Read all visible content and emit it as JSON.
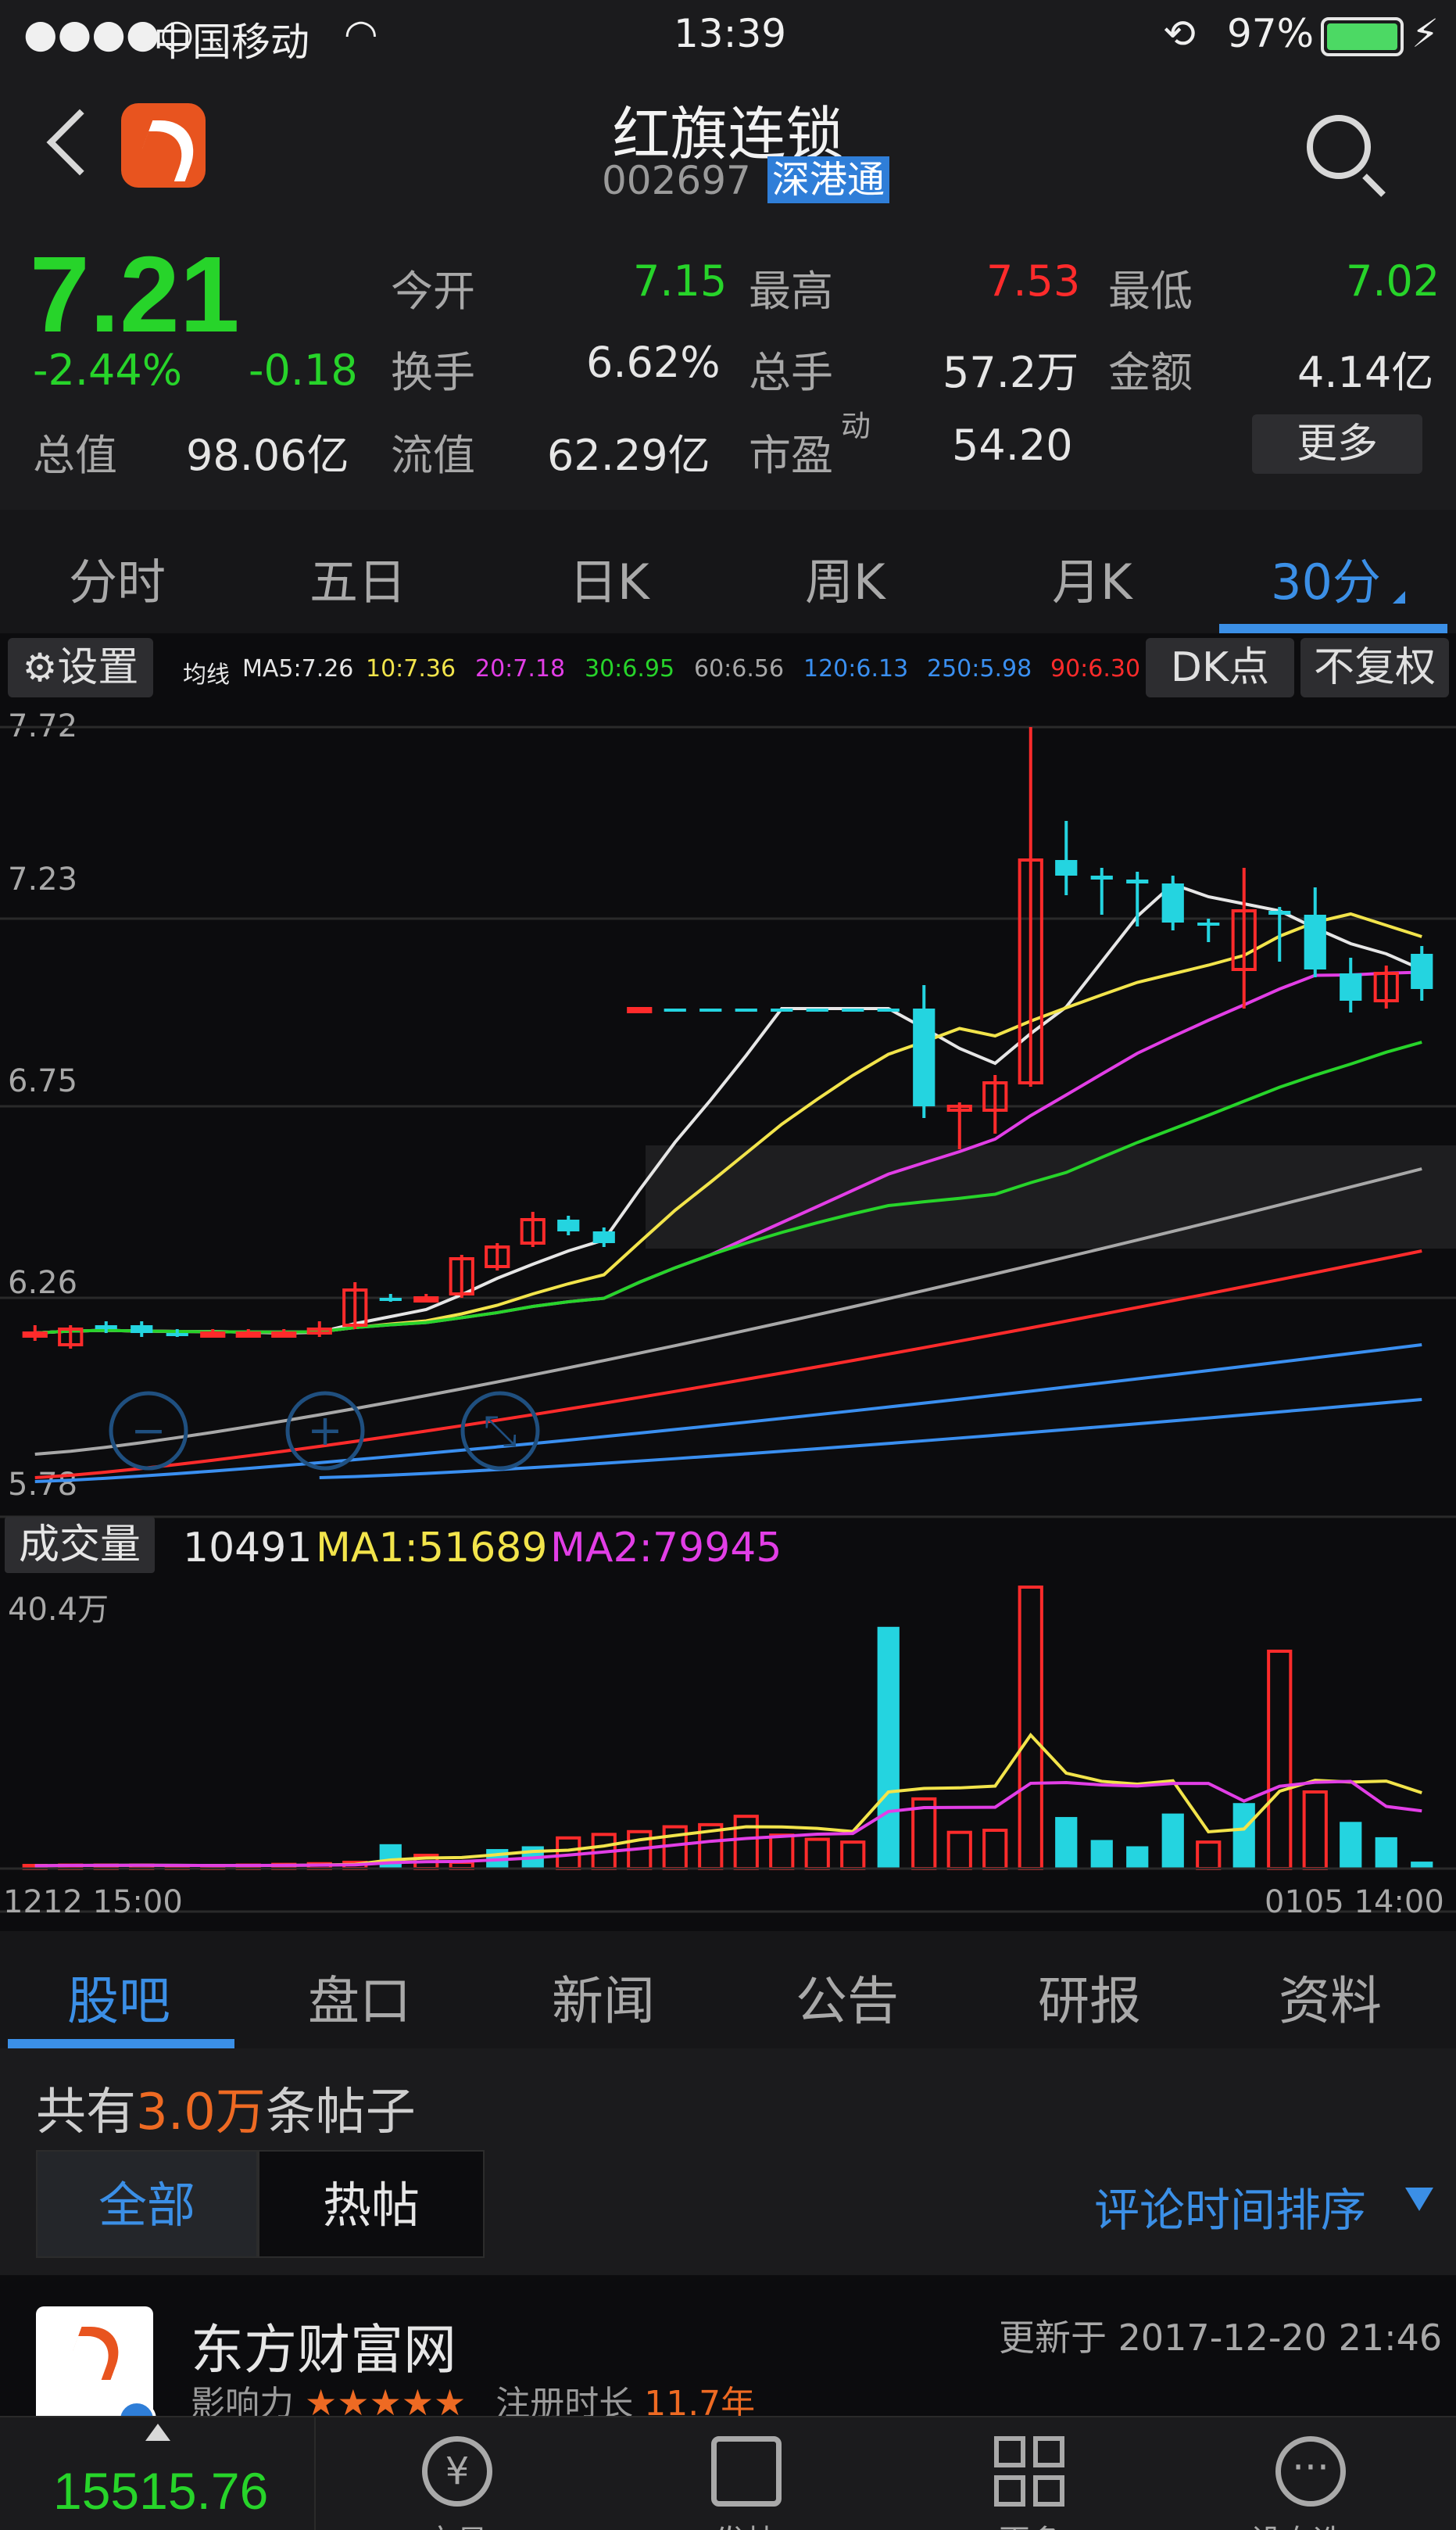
{
  "status_bar": {
    "signal": "●●●●○",
    "carrier": "中国移动",
    "wifi_icon": "wifi-icon",
    "time": "13:39",
    "battery_pct": "97%"
  },
  "header": {
    "stock_name": "红旗连锁",
    "stock_code": "002697",
    "connect_badge": "深港通"
  },
  "quote": {
    "price": "7.21",
    "change_pct": "-2.44%",
    "change": "-0.18",
    "open_label": "今开",
    "open": "7.15",
    "high_label": "最高",
    "high": "7.53",
    "low_label": "最低",
    "low": "7.02",
    "turnover_label": "换手",
    "turnover": "6.62%",
    "volume_label": "总手",
    "volume": "57.2万",
    "amount_label": "金额",
    "amount": "4.14亿",
    "mktcap_label": "总值",
    "mktcap": "98.06亿",
    "float_label": "流值",
    "float": "62.29亿",
    "pe_label": "市盈",
    "pe_sup": "动",
    "pe": "54.20",
    "more_button": "更多"
  },
  "period_tabs": [
    "分时",
    "五日",
    "日K",
    "周K",
    "月K",
    "30分"
  ],
  "indicator": {
    "settings_label": "设置",
    "ma_label": "均线",
    "ma_items": [
      {
        "text": "MA5:7.26",
        "color": "#e6e6e6"
      },
      {
        "text": "10:7.36",
        "color": "#f2e44b"
      },
      {
        "text": "20:7.18",
        "color": "#e23ee6"
      },
      {
        "text": "30:6.95",
        "color": "#27d42a"
      },
      {
        "text": "60:6.56",
        "color": "#a8a8a8"
      },
      {
        "text": "120:6.13",
        "color": "#3a8ff0"
      },
      {
        "text": "250:5.98",
        "color": "#3a8ff0"
      },
      {
        "text": "90:6.30",
        "color": "#ff2b2b"
      }
    ],
    "dk_button": "DK点",
    "adjust_button": "不复权"
  },
  "price_axis": [
    "7.72",
    "7.23",
    "6.75",
    "6.26",
    "5.78"
  ],
  "volume": {
    "label": "成交量",
    "value": "10491",
    "ma1": "MA1:51689",
    "ma2": "MA2:79945",
    "axis_max": "40.4万",
    "date_start": "1212 15:00",
    "date_end": "0105 14:00"
  },
  "chart_data": {
    "type": "candlestick",
    "ylim": [
      5.78,
      7.72
    ],
    "candles": [
      {
        "o": 6.17,
        "c": 6.17,
        "h": 6.19,
        "l": 6.15,
        "up": true
      },
      {
        "o": 6.14,
        "c": 6.18,
        "h": 6.19,
        "l": 6.13,
        "up": true
      },
      {
        "o": 6.19,
        "c": 6.18,
        "h": 6.2,
        "l": 6.17,
        "up": false
      },
      {
        "o": 6.19,
        "c": 6.17,
        "h": 6.2,
        "l": 6.16,
        "up": false
      },
      {
        "o": 6.17,
        "c": 6.17,
        "h": 6.18,
        "l": 6.16,
        "up": false
      },
      {
        "o": 6.17,
        "c": 6.17,
        "h": 6.18,
        "l": 6.16,
        "up": true
      },
      {
        "o": 6.17,
        "c": 6.17,
        "h": 6.18,
        "l": 6.16,
        "up": true
      },
      {
        "o": 6.17,
        "c": 6.17,
        "h": 6.18,
        "l": 6.16,
        "up": true
      },
      {
        "o": 6.17,
        "c": 6.18,
        "h": 6.2,
        "l": 6.16,
        "up": true
      },
      {
        "o": 6.19,
        "c": 6.28,
        "h": 6.3,
        "l": 6.18,
        "up": true
      },
      {
        "o": 6.26,
        "c": 6.26,
        "h": 6.27,
        "l": 6.25,
        "up": false
      },
      {
        "o": 6.26,
        "c": 6.26,
        "h": 6.27,
        "l": 6.25,
        "up": true
      },
      {
        "o": 6.27,
        "c": 6.36,
        "h": 6.37,
        "l": 6.26,
        "up": true
      },
      {
        "o": 6.34,
        "c": 6.39,
        "h": 6.4,
        "l": 6.33,
        "up": true
      },
      {
        "o": 6.4,
        "c": 6.46,
        "h": 6.48,
        "l": 6.39,
        "up": true
      },
      {
        "o": 6.46,
        "c": 6.43,
        "h": 6.47,
        "l": 6.42,
        "up": false
      },
      {
        "o": 6.43,
        "c": 6.4,
        "h": 6.44,
        "l": 6.39,
        "up": false
      },
      {
        "o": 7.0,
        "c": 7.0,
        "h": 7.0,
        "l": 7.0,
        "up": true
      },
      {
        "o": 7.0,
        "c": 7.0,
        "h": 7.0,
        "l": 7.0,
        "up": false
      },
      {
        "o": 7.0,
        "c": 7.0,
        "h": 7.0,
        "l": 7.0,
        "up": false
      },
      {
        "o": 7.0,
        "c": 7.0,
        "h": 7.0,
        "l": 7.0,
        "up": false
      },
      {
        "o": 7.0,
        "c": 7.0,
        "h": 7.0,
        "l": 7.0,
        "up": false
      },
      {
        "o": 7.0,
        "c": 7.0,
        "h": 7.0,
        "l": 7.0,
        "up": false
      },
      {
        "o": 7.0,
        "c": 7.0,
        "h": 7.0,
        "l": 7.0,
        "up": false
      },
      {
        "o": 7.0,
        "c": 7.0,
        "h": 7.0,
        "l": 7.0,
        "up": false
      },
      {
        "o": 7.0,
        "c": 6.75,
        "h": 7.06,
        "l": 6.72,
        "up": false
      },
      {
        "o": 6.75,
        "c": 6.74,
        "h": 6.76,
        "l": 6.64,
        "up": true
      },
      {
        "o": 6.74,
        "c": 6.81,
        "h": 6.83,
        "l": 6.68,
        "up": true
      },
      {
        "o": 6.81,
        "c": 7.38,
        "h": 7.72,
        "l": 6.8,
        "up": true
      },
      {
        "o": 7.38,
        "c": 7.34,
        "h": 7.48,
        "l": 7.29,
        "up": false
      },
      {
        "o": 7.34,
        "c": 7.33,
        "h": 7.36,
        "l": 7.24,
        "up": false
      },
      {
        "o": 7.33,
        "c": 7.32,
        "h": 7.35,
        "l": 7.21,
        "up": false
      },
      {
        "o": 7.32,
        "c": 7.22,
        "h": 7.34,
        "l": 7.2,
        "up": false
      },
      {
        "o": 7.22,
        "c": 7.22,
        "h": 7.23,
        "l": 7.17,
        "up": false
      },
      {
        "o": 7.1,
        "c": 7.25,
        "h": 7.36,
        "l": 7.0,
        "up": true
      },
      {
        "o": 7.25,
        "c": 7.24,
        "h": 7.26,
        "l": 7.12,
        "up": false
      },
      {
        "o": 7.24,
        "c": 7.1,
        "h": 7.31,
        "l": 7.08,
        "up": false
      },
      {
        "o": 7.09,
        "c": 7.02,
        "h": 7.13,
        "l": 6.99,
        "up": false
      },
      {
        "o": 7.02,
        "c": 7.09,
        "h": 7.11,
        "l": 7.0,
        "up": true
      },
      {
        "o": 7.14,
        "c": 7.05,
        "h": 7.16,
        "l": 7.02,
        "up": false
      }
    ],
    "volumes": [
      0.4,
      0.5,
      0.5,
      0.5,
      0.4,
      0.3,
      0.5,
      0.6,
      0.7,
      0.9,
      3.5,
      1.9,
      0.9,
      2.8,
      3.2,
      4.4,
      4.9,
      5.3,
      6.0,
      6.3,
      7.5,
      4.8,
      4.2,
      3.8,
      34.7,
      10.0,
      5.2,
      5.5,
      40.4,
      7.4,
      4.1,
      3.2,
      7.9,
      3.8,
      9.4,
      31.2,
      11.0,
      6.7,
      4.5,
      1.0
    ],
    "volume_colors": [
      "r",
      "r",
      "r",
      "r",
      "r",
      "r",
      "r",
      "r",
      "r",
      "r",
      "c",
      "r",
      "r",
      "c",
      "c",
      "r",
      "r",
      "r",
      "r",
      "r",
      "r",
      "r",
      "r",
      "r",
      "c",
      "r",
      "r",
      "r",
      "r",
      "c",
      "c",
      "c",
      "c",
      "r",
      "c",
      "r",
      "r",
      "c",
      "c",
      "c"
    ],
    "volume_ylim": [
      0,
      40.4
    ]
  },
  "info_tabs": [
    "股吧",
    "盘口",
    "新闻",
    "公告",
    "研报",
    "资料"
  ],
  "forum": {
    "post_count_prefix": "共有",
    "post_count": "3.0万",
    "post_count_suffix": "条帖子",
    "seg_all": "全部",
    "seg_hot": "热帖",
    "sort_label": "评论时间排序"
  },
  "post": {
    "author": "东方财富网",
    "updated": "更新于 2017-12-20 21:46",
    "influence_label": "影响力",
    "stars": "★★★★★",
    "reg_label": "注册时长",
    "reg_value": "11.7年"
  },
  "bottom_bar": {
    "index_value": "15515.76",
    "nav_items": [
      "交易",
      "发帖",
      "更多",
      "设自选"
    ]
  }
}
